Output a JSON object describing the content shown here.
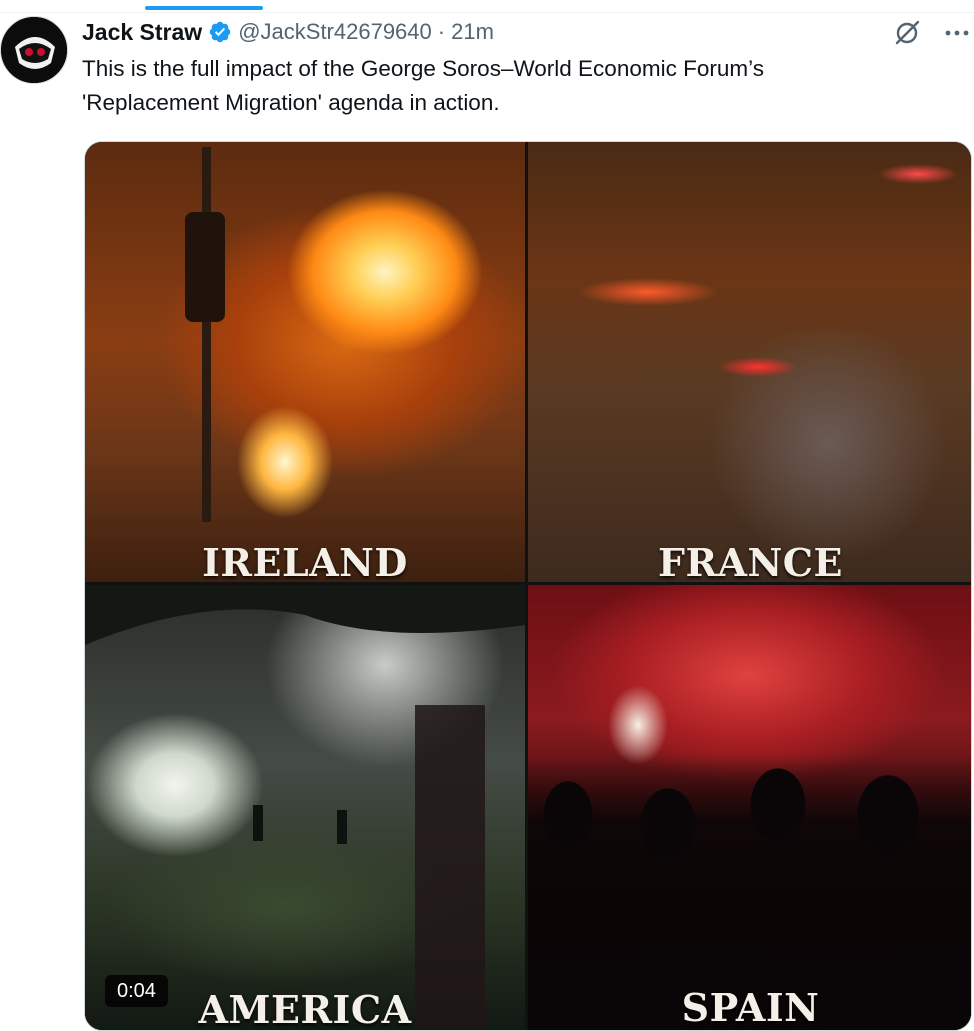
{
  "tweet": {
    "author": {
      "display_name": "Jack Straw",
      "handle": "@JackStr42679640",
      "verified": true,
      "avatar_icon": "skull-mask-avatar"
    },
    "separator": "·",
    "timestamp": "21m",
    "text": "This is the full impact of the George Soros–World Economic Forum’s\n'Replacement Migration' agenda in action.",
    "actions": {
      "grok_icon": "grok-slash-icon",
      "more_icon": "more-ellipsis-icon"
    }
  },
  "media": {
    "type": "video",
    "duration": "0:04",
    "panels": [
      {
        "label": "IRELAND"
      },
      {
        "label": "FRANCE"
      },
      {
        "label": "AMERICA"
      },
      {
        "label": "SPAIN"
      }
    ]
  },
  "colors": {
    "accent": "#1d9bf0",
    "text_primary": "#0f1419",
    "text_secondary": "#536471"
  }
}
